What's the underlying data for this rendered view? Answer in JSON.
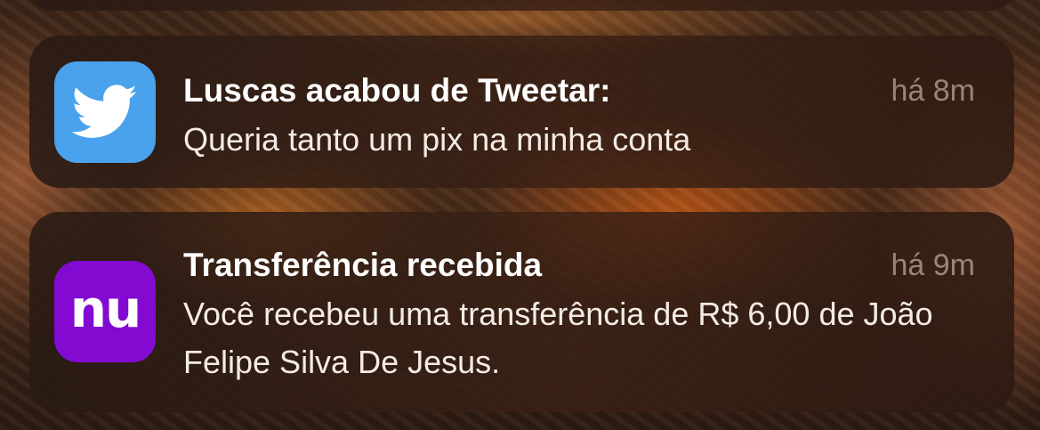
{
  "notifications": [
    {
      "app": "Twitter",
      "icon": "twitter-bird-icon",
      "icon_color": "#4aa1ec",
      "title": "Luscas acabou de Tweetar:",
      "time": "há 8m",
      "body": "Queria tanto um pix na minha conta"
    },
    {
      "app": "Nubank",
      "icon": "nubank-logo-icon",
      "icon_color": "#820ad1",
      "icon_text": "nu",
      "title": "Transferência recebida",
      "time": "há 9m",
      "body": "Você recebeu uma transferência de R$ 6,00 de João Felipe Silva De Jesus."
    }
  ]
}
